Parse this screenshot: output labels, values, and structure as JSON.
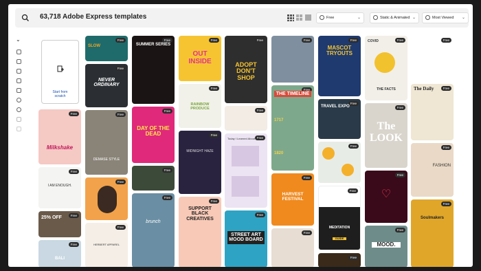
{
  "header": {
    "title": "63,718 Adobe Express templates"
  },
  "filters": [
    {
      "label": "Free",
      "icon": "filter-icon"
    },
    {
      "label": "Static & Animated",
      "icon": "image-icon"
    },
    {
      "label": "Most Viewed",
      "icon": "eye-icon"
    }
  ],
  "start": {
    "line1": "Start from",
    "line2": "scratch"
  },
  "badge": "Free",
  "cards": {
    "c1": "Milkshake",
    "c2": "I AM ENOUGH.",
    "c3": "25% OFF",
    "c4": "BALI",
    "c5": "SLOW",
    "c6": "NEVER ORDINARY",
    "c7": "DEMASE STYLE",
    "c8": "HERBERT APPAREL",
    "c9": "SUMMER SERIES",
    "c10": "DAY OF THE DEAD",
    "c11": "brunch",
    "c12": "OUT INSIDE",
    "c13": "RAINBOW PRODUCE",
    "c14": "MIDNIGHT HAZE",
    "c15": "SUPPORT BLACK CREATIVES",
    "c16": "ADOPT DON'T SHOP",
    "c17": "Today I Learned About",
    "c18": "STREET ART MOOD BOARD",
    "c19": "THE TIMELINE",
    "c20": "1717",
    "c21": "1820",
    "c22": "HARVEST FESTIVAL",
    "c23": "MASCOT TRYOUTS",
    "c24": "TRAVEL EXPO",
    "c25": "MEDITATION",
    "c26": "GUIDE",
    "c27": "COVID",
    "c28": "THE FACTS",
    "c29": "The LOOK",
    "c30": "MOOD.",
    "c31": "The Daily",
    "c32": "FASHION",
    "c33": "Soulmakers"
  }
}
